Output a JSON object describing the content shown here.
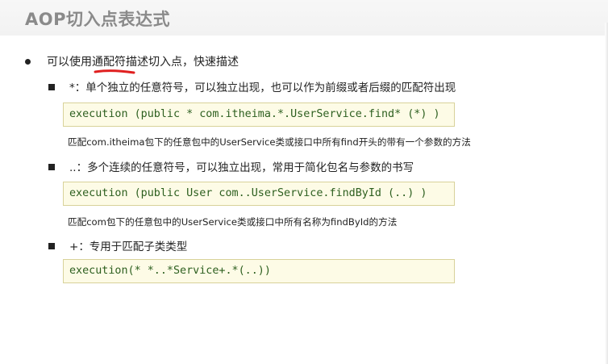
{
  "title": "AOP切入点表达式",
  "intro": {
    "before": "可以使用",
    "highlight": "通配符",
    "after": "描述切入点，快速描述"
  },
  "items": [
    {
      "symbol": "*",
      "text": "：单个独立的任意符号，可以独立出现，也可以作为前缀或者后缀的匹配符出现",
      "code": "execution (public * com.itheima.*.UserService.find* (*) )",
      "note": "匹配com.itheima包下的任意包中的UserService类或接口中所有find开头的带有一个参数的方法"
    },
    {
      "symbol": "..",
      "text": "：多个连续的任意符号，可以独立出现，常用于简化包名与参数的书写",
      "code": "execution (public User com..UserService.findById (..) )",
      "note": "匹配com包下的任意包中的UserService类或接口中所有名称为findById的方法"
    },
    {
      "symbol": "+",
      "text": "：专用于匹配子类类型",
      "code": "execution(* *..*Service+.*(..))",
      "note": ""
    }
  ],
  "colors": {
    "title": "#8a8a8a",
    "code_text": "#2d5f1f",
    "code_bg": "#fdfbe6",
    "code_border": "#d8d29a",
    "highlight_underline": "#e02020"
  }
}
